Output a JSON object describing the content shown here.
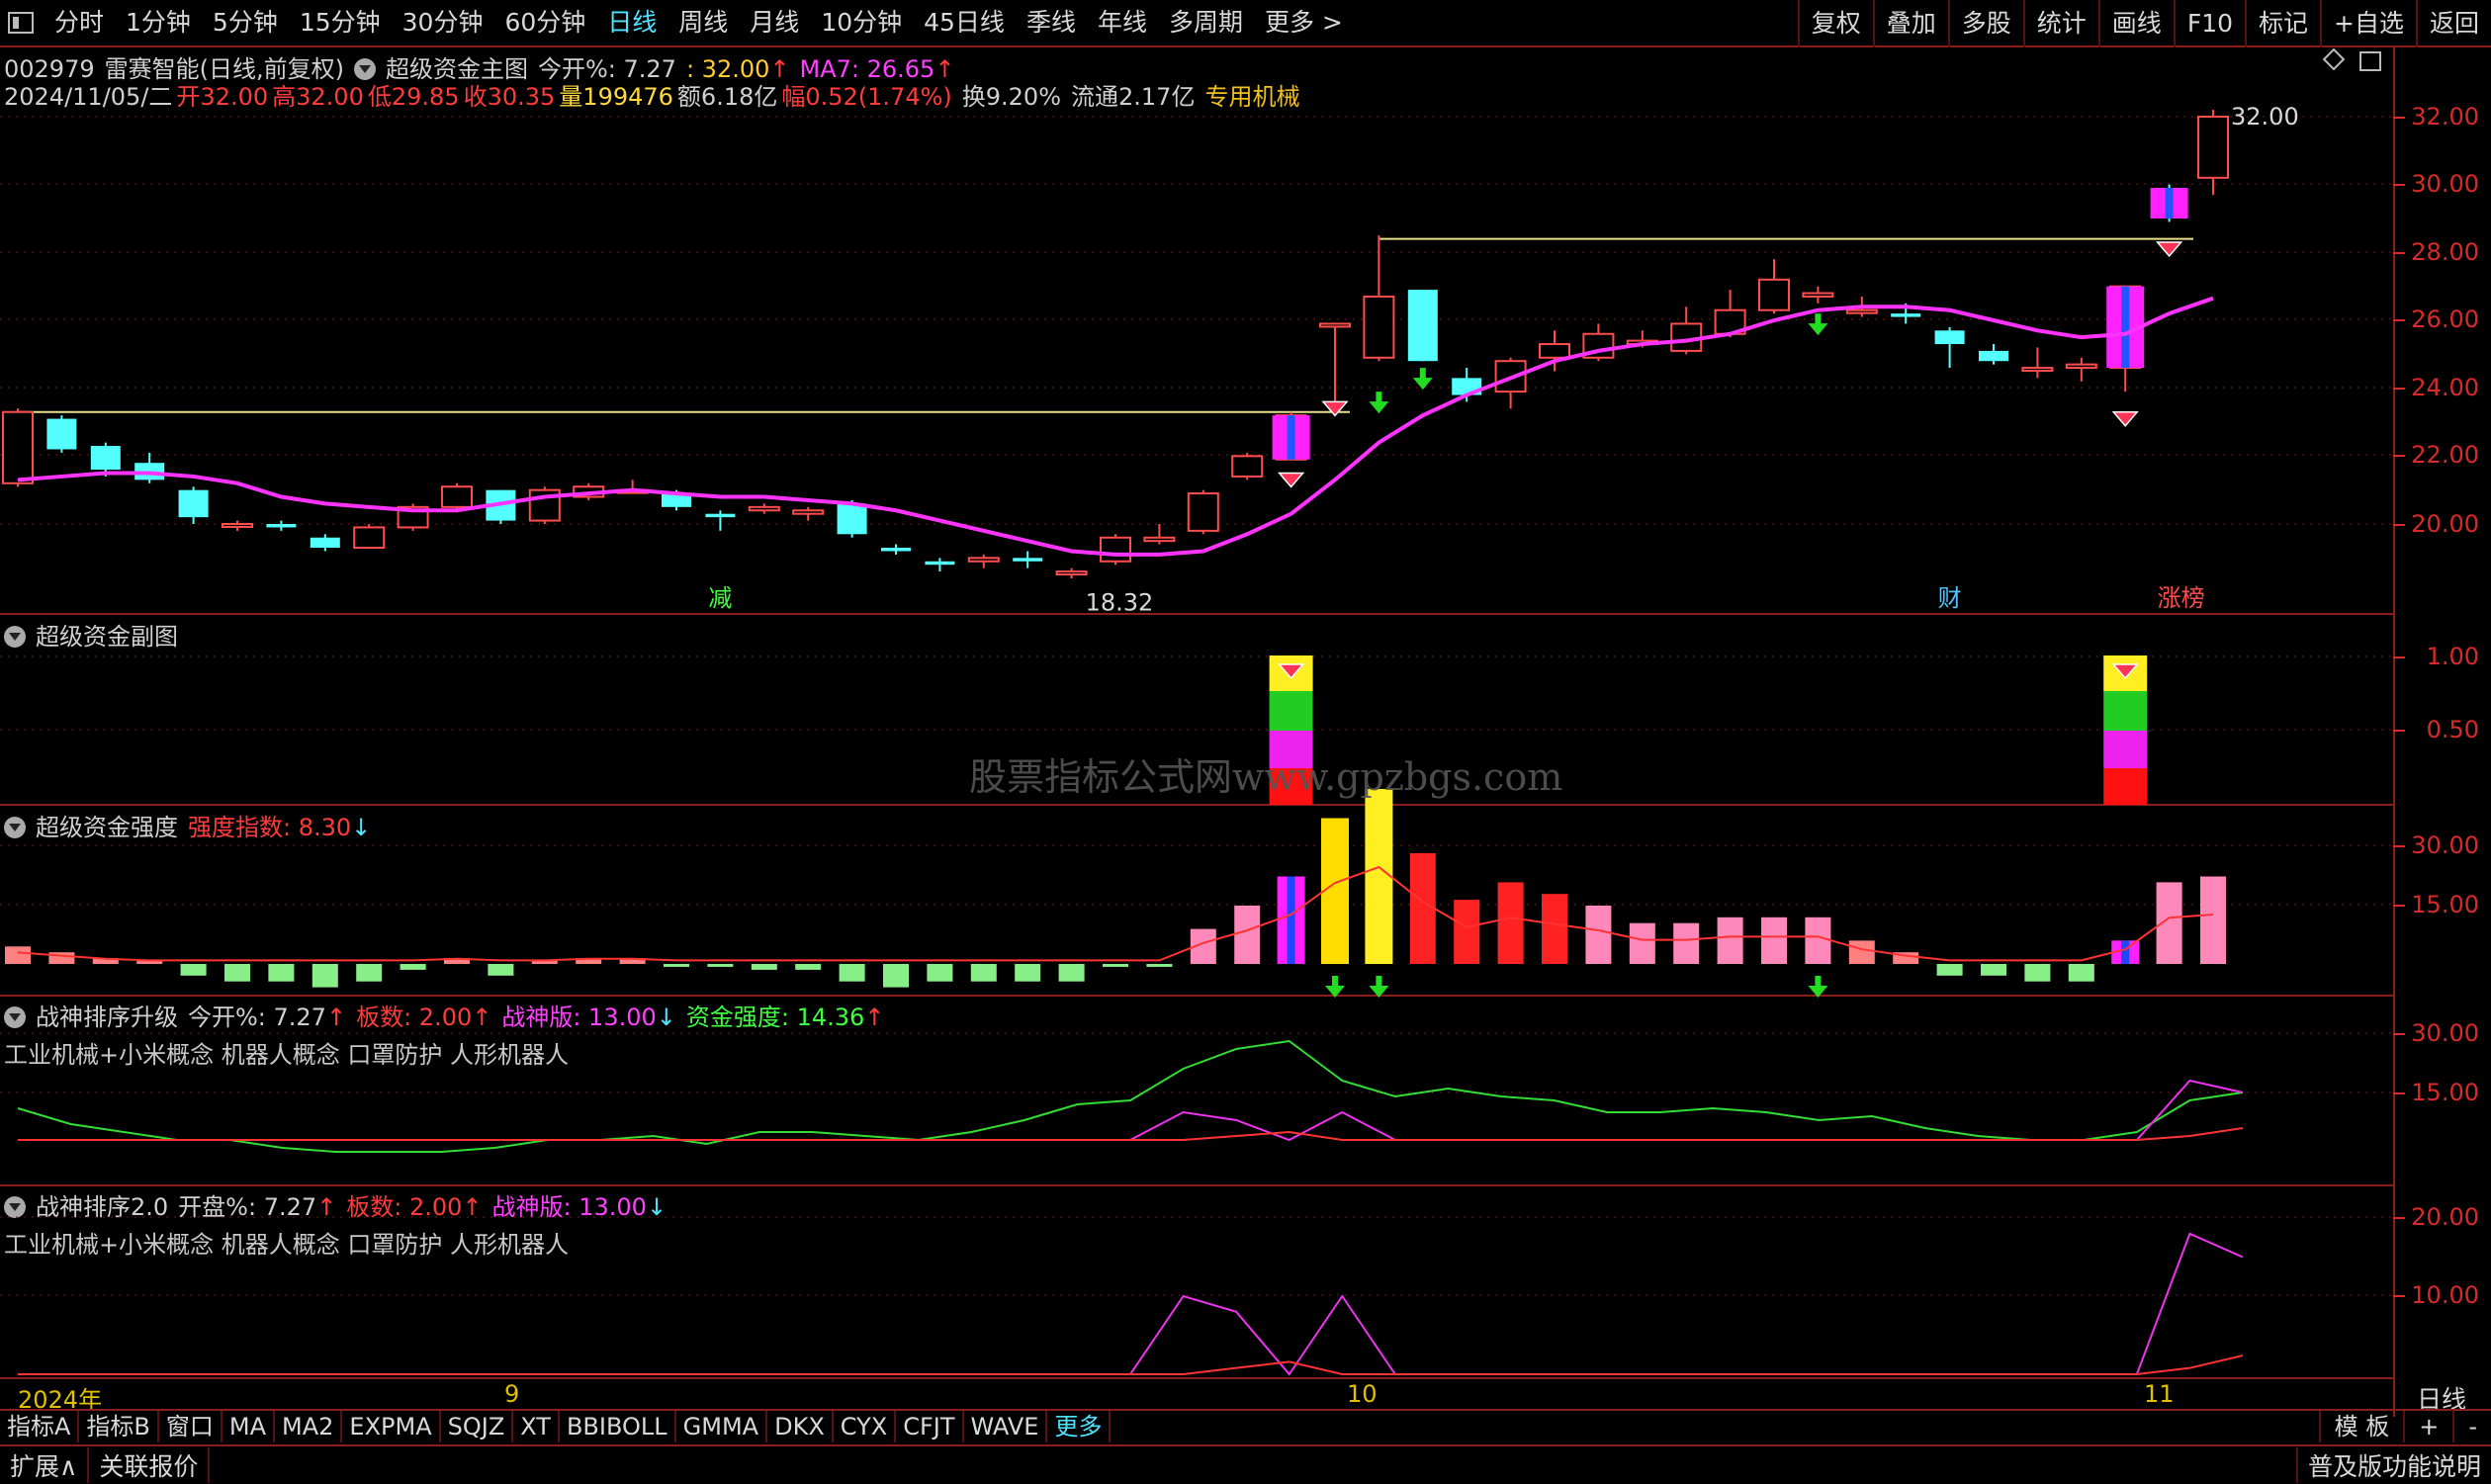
{
  "topbar": {
    "tabs": [
      "分时",
      "1分钟",
      "5分钟",
      "15分钟",
      "30分钟",
      "60分钟",
      "日线",
      "周线",
      "月线",
      "10分钟",
      "45日线",
      "季线",
      "年线",
      "多周期",
      "更多 >"
    ],
    "active": 6,
    "right": [
      "复权",
      "叠加",
      "多股",
      "统计",
      "画线",
      "F10",
      "标记",
      "+自选",
      "返回"
    ]
  },
  "info": {
    "code": "002979",
    "name": "雷赛智能(日线,前复权)",
    "indicator": "超级资金主图",
    "today_open_label": "今开%: 7.27",
    "price_label": ": 32.00",
    "ma_label": "MA7: 26.65",
    "date": "2024/11/05/二",
    "open": "开32.00",
    "high": "高32.00",
    "low": "低29.85",
    "close": "收30.35",
    "vol": "量199476",
    "amt": "额6.18亿",
    "chg": "幅0.52(1.74%)",
    "turn": "换9.20%",
    "float": "流通2.17亿",
    "industry": "专用机械"
  },
  "main_axis": [
    "32.00",
    "30.00",
    "28.00",
    "26.00",
    "24.00",
    "22.00",
    "20.00"
  ],
  "main_marks": {
    "high": "32.00",
    "low": "18.32",
    "tag1": "减",
    "tag2": "财",
    "tag3": "涨榜"
  },
  "panel2": {
    "title": "超级资金副图",
    "axis": [
      "1.00",
      "0.50"
    ]
  },
  "panel3": {
    "title": "超级资金强度",
    "label": "强度指数: 8.30",
    "axis": [
      "30.00",
      "15.00"
    ]
  },
  "panel4": {
    "title": "战神排序升级",
    "l1": "今开%: 7.27",
    "l2": "板数: 2.00",
    "l3": "战神版: 13.00",
    "l4": "资金强度: 14.36",
    "concepts": "工业机械+小米概念 机器人概念 口罩防护 人形机器人",
    "axis": [
      "30.00",
      "15.00"
    ]
  },
  "panel5": {
    "title": "战神排序2.0",
    "l1": "开盘%: 7.27",
    "l2": "板数: 2.00",
    "l3": "战神版: 13.00",
    "concepts": "工业机械+小米概念 机器人概念 口罩防护 人形机器人",
    "axis": [
      "20.00",
      "10.00"
    ]
  },
  "xaxis": {
    "labels": [
      "2024年",
      "9",
      "10",
      "11"
    ],
    "right": "日线"
  },
  "watermark": "股票指标公式网www.gpzbgs.com",
  "bottom1": {
    "tabs": [
      "指标A",
      "指标B",
      "窗口",
      "MA",
      "MA2",
      "EXPMA",
      "SQJZ",
      "XT",
      "BBIBOLL",
      "GMMA",
      "DKX",
      "CYX",
      "CFJT",
      "WAVE",
      "更多"
    ],
    "active": 14,
    "right": [
      "模 板",
      "+",
      "-"
    ]
  },
  "bottom2": {
    "left": [
      "扩展∧",
      "关联报价"
    ],
    "right": "普及版功能说明"
  },
  "chart_data": {
    "type": "candlestick",
    "ohlc": [
      [
        21.2,
        23.4,
        21.1,
        23.3
      ],
      [
        23.1,
        23.2,
        22.1,
        22.2
      ],
      [
        22.3,
        22.4,
        21.4,
        21.6
      ],
      [
        21.8,
        22.1,
        21.2,
        21.3
      ],
      [
        21.0,
        21.1,
        20.0,
        20.2
      ],
      [
        20.0,
        20.1,
        19.8,
        20.0
      ],
      [
        20.0,
        20.1,
        19.8,
        19.9
      ],
      [
        19.6,
        19.7,
        19.2,
        19.3
      ],
      [
        19.3,
        20.0,
        19.3,
        19.9
      ],
      [
        19.9,
        20.6,
        19.8,
        20.5
      ],
      [
        20.5,
        21.2,
        20.4,
        21.1
      ],
      [
        21.0,
        21.0,
        20.0,
        20.1
      ],
      [
        20.1,
        21.1,
        20.0,
        21.0
      ],
      [
        20.8,
        21.2,
        20.7,
        21.1
      ],
      [
        21.0,
        21.3,
        20.9,
        21.0
      ],
      [
        20.9,
        21.0,
        20.4,
        20.5
      ],
      [
        20.3,
        20.4,
        19.8,
        20.2
      ],
      [
        20.4,
        20.6,
        20.3,
        20.5
      ],
      [
        20.3,
        20.5,
        20.1,
        20.4
      ],
      [
        20.6,
        20.7,
        19.6,
        19.7
      ],
      [
        19.3,
        19.4,
        19.1,
        19.2
      ],
      [
        18.9,
        19.0,
        18.6,
        18.8
      ],
      [
        18.9,
        19.1,
        18.7,
        19.0
      ],
      [
        19.0,
        19.2,
        18.7,
        18.9
      ],
      [
        18.6,
        18.7,
        18.4,
        18.6
      ],
      [
        18.9,
        19.7,
        18.8,
        19.6
      ],
      [
        19.5,
        20.0,
        19.4,
        19.6
      ],
      [
        19.8,
        21.0,
        19.7,
        20.9
      ],
      [
        21.4,
        22.1,
        21.3,
        22.0
      ],
      [
        21.9,
        23.3,
        21.9,
        23.2
      ],
      [
        25.9,
        25.9,
        23.6,
        25.9
      ],
      [
        24.9,
        28.5,
        24.8,
        26.7
      ],
      [
        26.9,
        26.9,
        24.8,
        24.8
      ],
      [
        24.3,
        24.6,
        23.6,
        23.8
      ],
      [
        23.9,
        24.9,
        23.4,
        24.8
      ],
      [
        24.9,
        25.7,
        24.5,
        25.3
      ],
      [
        24.9,
        25.9,
        24.8,
        25.6
      ],
      [
        25.3,
        25.7,
        25.2,
        25.4
      ],
      [
        25.1,
        26.4,
        25.0,
        25.9
      ],
      [
        25.6,
        26.9,
        25.5,
        26.3
      ],
      [
        26.3,
        27.8,
        26.2,
        27.2
      ],
      [
        26.7,
        27.0,
        26.5,
        26.8
      ],
      [
        26.3,
        26.7,
        26.1,
        26.3
      ],
      [
        26.2,
        26.5,
        25.9,
        26.1
      ],
      [
        25.7,
        25.8,
        24.6,
        25.3
      ],
      [
        25.1,
        25.3,
        24.7,
        24.8
      ],
      [
        24.6,
        25.2,
        24.3,
        24.6
      ],
      [
        24.6,
        24.9,
        24.2,
        24.7
      ],
      [
        24.6,
        27.0,
        23.9,
        27.0
      ],
      [
        29.9,
        30.0,
        28.9,
        29.0
      ],
      [
        30.2,
        32.2,
        29.7,
        32.0
      ]
    ],
    "ma7": [
      21.3,
      21.4,
      21.5,
      21.5,
      21.4,
      21.2,
      20.8,
      20.6,
      20.5,
      20.4,
      20.4,
      20.6,
      20.8,
      20.9,
      21.0,
      20.9,
      20.8,
      20.8,
      20.7,
      20.6,
      20.4,
      20.1,
      19.8,
      19.5,
      19.2,
      19.1,
      19.1,
      19.2,
      19.7,
      20.3,
      21.3,
      22.4,
      23.2,
      23.8,
      24.3,
      24.8,
      25.1,
      25.3,
      25.4,
      25.6,
      26.0,
      26.3,
      26.4,
      26.4,
      26.3,
      26.0,
      25.7,
      25.5,
      25.6,
      26.2,
      26.65
    ],
    "strength": [
      3,
      2,
      1,
      0.5,
      -2,
      -3,
      -3,
      -4,
      -3,
      -1,
      1,
      -2,
      0.5,
      1,
      1,
      -0.5,
      -0.5,
      -1,
      -1,
      -3,
      -4,
      -3,
      -3,
      -3,
      -3,
      -0.5,
      -0.5,
      6,
      10,
      15,
      25,
      30,
      19,
      11,
      14,
      12,
      10,
      7,
      7,
      8,
      8,
      8,
      4,
      2,
      -2,
      -2,
      -3,
      -3,
      4,
      14,
      15
    ],
    "line_green": [
      11,
      7,
      5,
      3,
      3,
      1,
      0,
      0,
      0,
      1,
      3,
      3,
      4,
      2,
      5,
      5,
      4,
      3,
      5,
      8,
      12,
      13,
      21,
      26,
      28,
      18,
      14,
      16,
      14,
      13,
      10,
      10,
      11,
      10,
      8,
      9,
      6,
      4,
      3,
      3,
      5,
      13,
      15
    ],
    "line_magenta": [
      3,
      3,
      3,
      3,
      3,
      3,
      3,
      3,
      3,
      3,
      3,
      3,
      3,
      3,
      3,
      3,
      3,
      3,
      3,
      3,
      3,
      3,
      10,
      8,
      3,
      10,
      3,
      3,
      3,
      3,
      3,
      3,
      3,
      3,
      3,
      3,
      3,
      3,
      3,
      3,
      3,
      18,
      15
    ],
    "line_red": [
      3,
      3,
      3,
      3,
      3,
      3,
      3,
      3,
      3,
      3,
      3,
      3,
      3,
      3,
      3,
      3,
      3,
      3,
      3,
      3,
      3,
      3,
      3,
      4,
      5,
      3,
      3,
      3,
      3,
      3,
      3,
      3,
      3,
      3,
      3,
      3,
      3,
      3,
      3,
      3,
      3,
      4,
      6
    ]
  }
}
